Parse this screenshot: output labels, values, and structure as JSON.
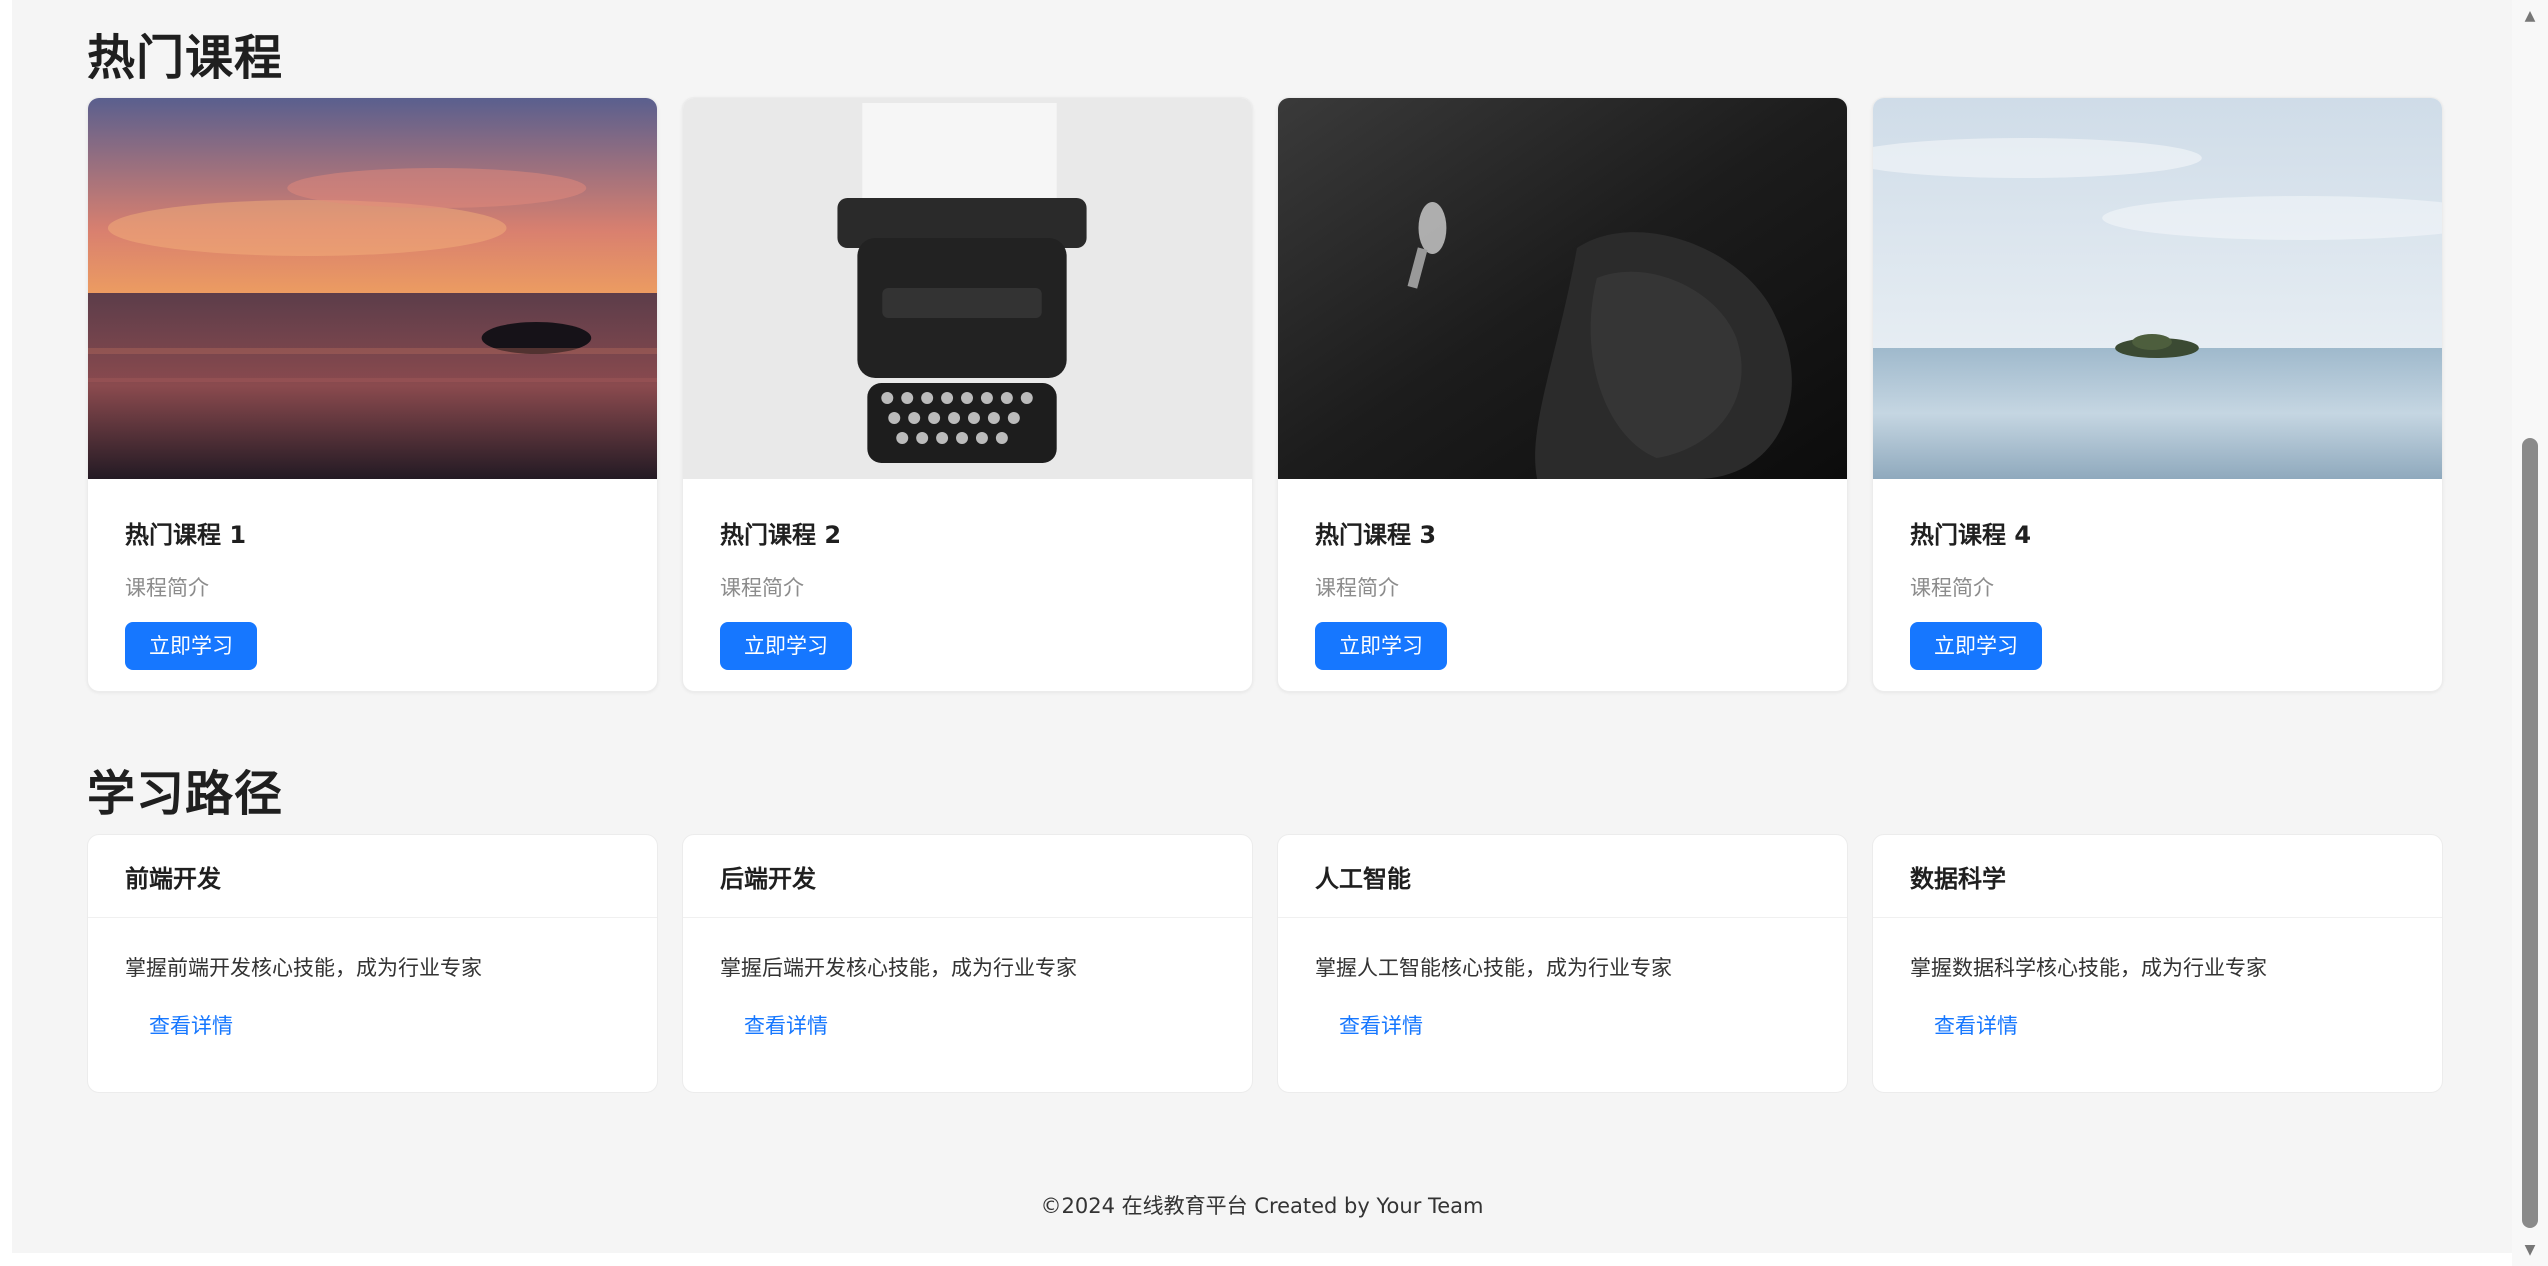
{
  "hot_courses": {
    "title": "热门课程",
    "cards": [
      {
        "title": "热门课程 1",
        "desc": "课程简介",
        "button": "立即学习",
        "image": "sunset-sea"
      },
      {
        "title": "热门课程 2",
        "desc": "课程简介",
        "button": "立即学习",
        "image": "typewriter"
      },
      {
        "title": "热门课程 3",
        "desc": "课程简介",
        "button": "立即学习",
        "image": "diver-underwater"
      },
      {
        "title": "热门课程 4",
        "desc": "课程简介",
        "button": "立即学习",
        "image": "island-sea"
      }
    ]
  },
  "learning_paths": {
    "title": "学习路径",
    "cards": [
      {
        "title": "前端开发",
        "desc": "掌握前端开发核心技能，成为行业专家",
        "link": "查看详情"
      },
      {
        "title": "后端开发",
        "desc": "掌握后端开发核心技能，成为行业专家",
        "link": "查看详情"
      },
      {
        "title": "人工智能",
        "desc": "掌握人工智能核心技能，成为行业专家",
        "link": "查看详情"
      },
      {
        "title": "数据科学",
        "desc": "掌握数据科学核心技能，成为行业专家",
        "link": "查看详情"
      }
    ]
  },
  "footer": {
    "text": "©2024 在线教育平台 Created by Your Team"
  },
  "colors": {
    "primary": "#1677ff",
    "background": "#f5f5f5"
  }
}
